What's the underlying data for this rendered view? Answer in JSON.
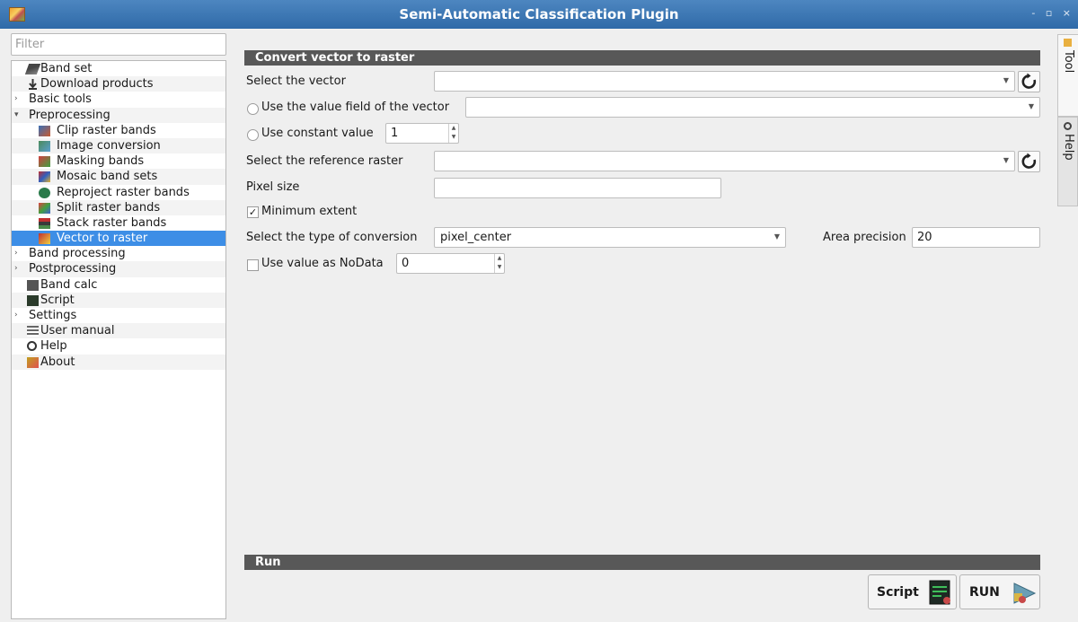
{
  "window": {
    "title": "Semi-Automatic Classification Plugin",
    "controls": "- ▫ ×"
  },
  "sidebar": {
    "filter_placeholder": "Filter",
    "items": [
      {
        "label": "Band set",
        "icon": "band-set-icon",
        "level": 0,
        "expandable": false
      },
      {
        "label": "Download products",
        "icon": "download-icon",
        "level": 0,
        "expandable": false
      },
      {
        "label": "Basic tools",
        "level": 0,
        "expandable": true,
        "expanded": false
      },
      {
        "label": "Preprocessing",
        "level": 0,
        "expandable": true,
        "expanded": true
      },
      {
        "label": "Clip raster bands",
        "icon": "clip-icon",
        "level": 1
      },
      {
        "label": "Image conversion",
        "icon": "image-conversion-icon",
        "level": 1
      },
      {
        "label": "Masking bands",
        "icon": "masking-icon",
        "level": 1
      },
      {
        "label": "Mosaic band sets",
        "icon": "mosaic-icon",
        "level": 1
      },
      {
        "label": "Reproject raster bands",
        "icon": "reproject-icon",
        "level": 1
      },
      {
        "label": "Split raster bands",
        "icon": "split-icon",
        "level": 1
      },
      {
        "label": "Stack raster bands",
        "icon": "stack-icon",
        "level": 1
      },
      {
        "label": "Vector to raster",
        "icon": "vector-to-raster-icon",
        "level": 1,
        "selected": true
      },
      {
        "label": "Band processing",
        "level": 0,
        "expandable": true,
        "expanded": false
      },
      {
        "label": "Postprocessing",
        "level": 0,
        "expandable": true,
        "expanded": false
      },
      {
        "label": "Band calc",
        "icon": "band-calc-icon",
        "level": 0
      },
      {
        "label": "Script",
        "icon": "script-icon",
        "level": 0
      },
      {
        "label": "Settings",
        "level": 0,
        "expandable": true,
        "expanded": false
      },
      {
        "label": "User manual",
        "icon": "user-manual-icon",
        "level": 0
      },
      {
        "label": "Help",
        "icon": "help-icon",
        "level": 0
      },
      {
        "label": "About",
        "icon": "about-icon",
        "level": 0
      }
    ]
  },
  "side_tabs": {
    "tool": "Tool",
    "help": "Help"
  },
  "main": {
    "section_title": "Convert vector to raster",
    "select_vector_label": "Select the vector",
    "select_vector_value": "",
    "use_value_field_label": "Use the value field of the vector",
    "value_field_value": "",
    "use_constant_label": "Use constant value",
    "constant_value": "1",
    "select_reference_label": "Select the reference raster",
    "reference_value": "",
    "pixel_size_label": "Pixel size",
    "pixel_size_value": "",
    "minimum_extent_label": "Minimum extent",
    "minimum_extent_checked": true,
    "conversion_type_label": "Select the type of conversion",
    "conversion_type_value": "pixel_center",
    "area_precision_label": "Area precision",
    "area_precision_value": "20",
    "nodata_label": "Use value as NoData",
    "nodata_value": "0",
    "nodata_checked": false
  },
  "run": {
    "section_title": "Run",
    "script_label": "Script",
    "run_label": "RUN"
  },
  "colors": {
    "title_bar": "#3a78b6",
    "selection": "#3d8ee6",
    "section_header": "#585858"
  }
}
